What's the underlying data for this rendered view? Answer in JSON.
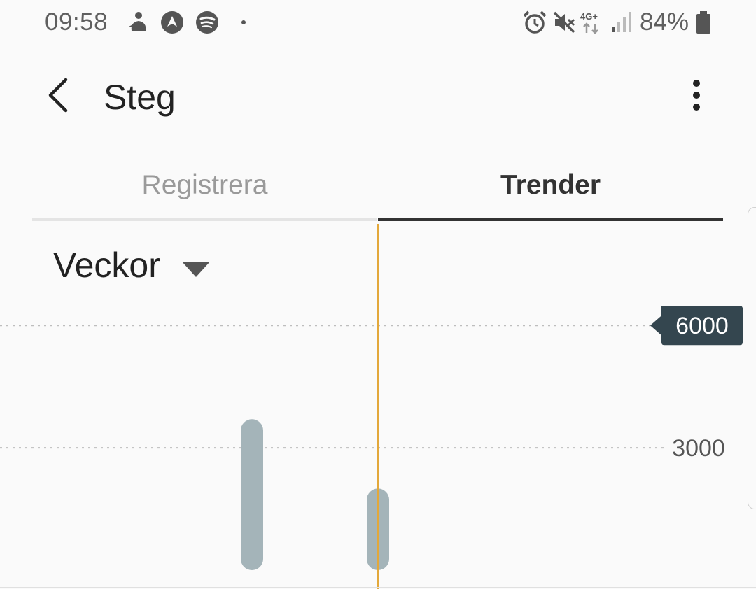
{
  "status_bar": {
    "time": "09:58",
    "battery": "84%",
    "icons": [
      "notification-app-icon",
      "navigation-app-icon",
      "spotify-icon",
      "dot-icon",
      "alarm-icon",
      "mute-icon",
      "network-4g-icon",
      "signal-icon",
      "battery-icon"
    ],
    "network_label": "4G+"
  },
  "app_bar": {
    "title": "Steg",
    "back_icon": "back-arrow-icon",
    "menu_icon": "more-vert-icon"
  },
  "tabs": [
    {
      "label": "Registrera",
      "selected": false
    },
    {
      "label": "Trender",
      "selected": true
    }
  ],
  "period_select": {
    "value": "Veckor",
    "icon": "dropdown-arrow-icon"
  },
  "colors": {
    "bar": "#a4b4b9",
    "cursor_line": "#e3a83a",
    "goal_badge": "#34464f",
    "gridline": "#bdbdbd",
    "tab_indicator": "#333333"
  },
  "chart_data": {
    "type": "bar",
    "goal_label": "6000",
    "gridline_labels": [
      "6000",
      "3000"
    ],
    "series": [
      {
        "values": [
          3700,
          2000
        ]
      }
    ],
    "ylim": [
      0,
      7200
    ],
    "gridlines": [
      6000,
      3000
    ]
  }
}
